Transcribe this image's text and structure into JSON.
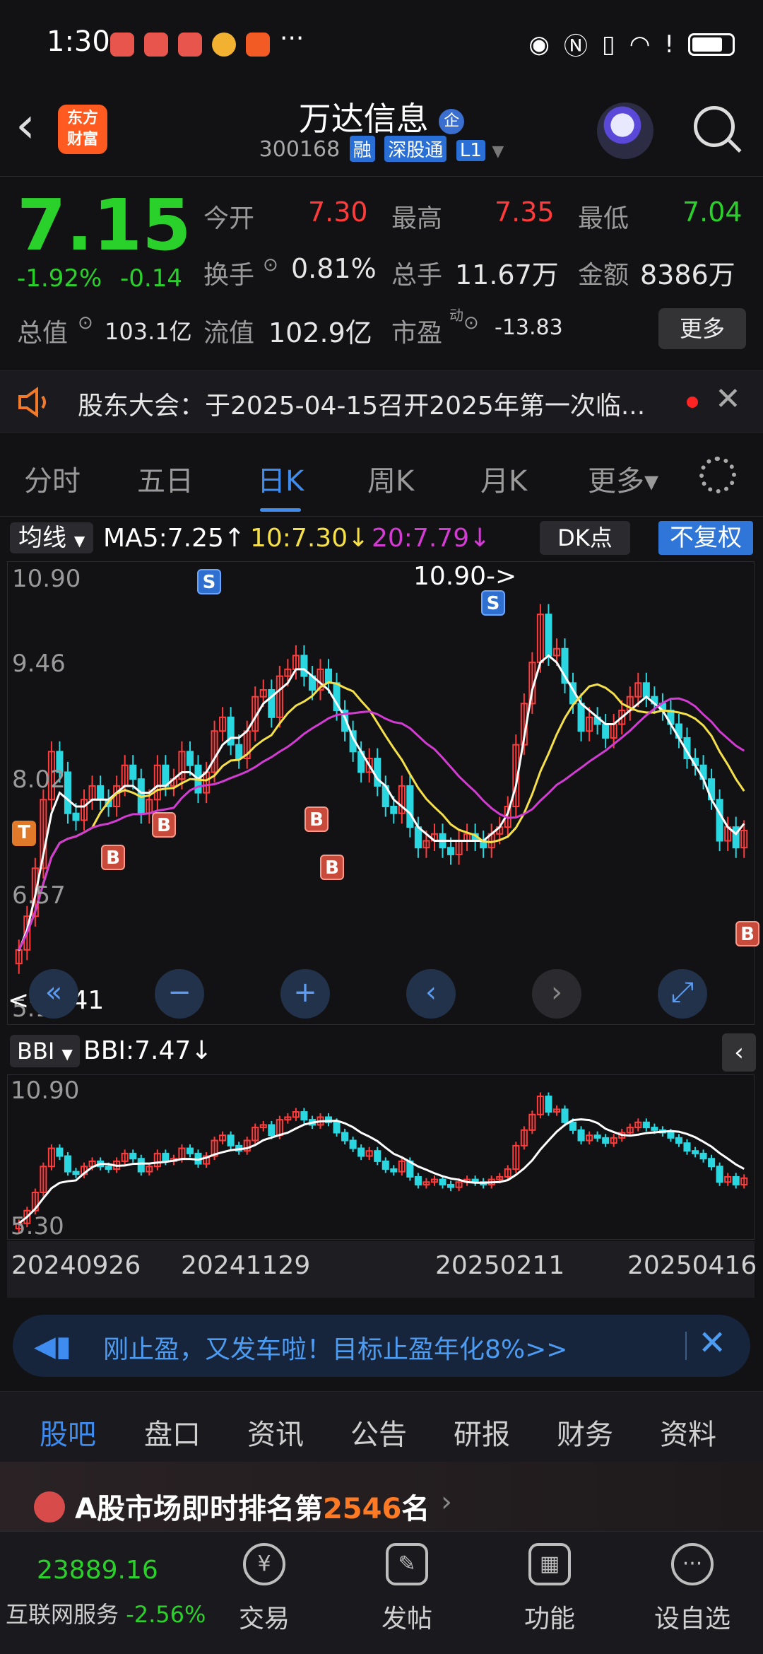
{
  "status_bar": {
    "time": "1:30",
    "more": "···"
  },
  "header": {
    "back_icon": "chevron-left-icon",
    "logo_line1": "东方",
    "logo_line2": "财富",
    "stock_name": "万达信息",
    "badge": "企",
    "code": "300168",
    "tags": [
      "融",
      "深股通",
      "L1"
    ]
  },
  "quote": {
    "price": "7.15",
    "change_pct": "-1.92%",
    "change_amt": "-0.14",
    "open_label": "今开",
    "open": "7.30",
    "high_label": "最高",
    "high": "7.35",
    "low_label": "最低",
    "low": "7.04",
    "turnover_label": "换手",
    "turnover": "0.81%",
    "volume_label": "总手",
    "volume": "11.67万",
    "amount_label": "金额",
    "amount": "8386万",
    "mktcap_label": "总值",
    "mktcap": "103.1亿",
    "float_label": "流值",
    "float": "102.9亿",
    "pe_label": "市盈",
    "pe_sup": "动",
    "pe": "-13.83",
    "more_button": "更多"
  },
  "notice": {
    "text": "股东大会：于2025-04-15召开2025年第一次临..."
  },
  "period_tabs": [
    "分时",
    "五日",
    "日K",
    "周K",
    "月K",
    "更多▾"
  ],
  "active_period": "日K",
  "ma_row": {
    "selector": "均线",
    "ma5": "MA5:7.25↑",
    "ma10": "10:7.30↓",
    "ma20": "20:7.79↓",
    "dk_button": "DK点",
    "adjust_button": "不复权",
    "colors": {
      "ma5": "#ffffff",
      "ma10": "#f5e04a",
      "ma20": "#d23cd2"
    }
  },
  "main_chart": {
    "y_ticks": [
      "10.90",
      "9.46",
      "8.02",
      "6.57",
      "5.13"
    ],
    "high_annotation": "10.90->",
    "low_annotation": "<--5.41",
    "markers": [
      "S",
      "S",
      "B",
      "B",
      "B",
      "B",
      "B",
      "T"
    ],
    "controls": [
      "«",
      "−",
      "+",
      "‹",
      "›",
      "⤢"
    ]
  },
  "bbi_row": {
    "selector": "BBI",
    "value": "BBI:7.47↓",
    "collapse": "‹"
  },
  "bbi_chart": {
    "y_ticks": [
      "10.90",
      "5.30"
    ]
  },
  "dates": [
    "20240926",
    "20241129",
    "20250211",
    "20250416"
  ],
  "promo": {
    "text": "刚止盈，又发车啦！目标止盈年化8%>>"
  },
  "bottom_tabs": [
    "股吧",
    "盘口",
    "资讯",
    "公告",
    "研报",
    "财务",
    "资料"
  ],
  "rank": {
    "prefix": "A股市场即时排名第",
    "number": "2546",
    "suffix": "名"
  },
  "bottom_nav": {
    "index_value": "23889.16",
    "index_name": "互联网服务",
    "index_change": "-2.56%",
    "items": [
      "交易",
      "发帖",
      "功能",
      "设自选"
    ]
  },
  "chart_data": {
    "type": "candlestick",
    "title": "",
    "x_range": [
      "20240926",
      "20250416"
    ],
    "ylim": [
      5.13,
      10.9
    ],
    "close": [
      5.41,
      5.9,
      6.6,
      7.6,
      8.3,
      8.0,
      7.4,
      7.3,
      7.6,
      7.8,
      7.6,
      7.5,
      7.8,
      8.1,
      7.9,
      7.4,
      7.6,
      8.1,
      7.8,
      7.9,
      8.3,
      8.1,
      7.7,
      8.0,
      8.6,
      8.8,
      8.4,
      8.2,
      8.6,
      9.1,
      9.2,
      8.8,
      9.4,
      9.5,
      9.7,
      9.4,
      9.2,
      9.5,
      9.3,
      8.9,
      8.6,
      8.3,
      8.0,
      8.2,
      7.8,
      7.5,
      7.4,
      7.8,
      7.2,
      6.9,
      7.0,
      7.1,
      6.9,
      6.8,
      7.0,
      7.1,
      7.0,
      6.9,
      7.1,
      7.2,
      7.5,
      8.4,
      9.0,
      9.6,
      10.3,
      9.7,
      9.8,
      9.3,
      9.0,
      8.6,
      8.8,
      8.7,
      8.5,
      8.7,
      8.9,
      9.1,
      9.3,
      9.1,
      9.0,
      8.9,
      8.7,
      8.5,
      8.2,
      8.1,
      7.9,
      7.6,
      7.0,
      7.2,
      6.9,
      7.15
    ],
    "ma5": [
      5.4,
      5.7,
      6.2,
      6.8,
      7.4,
      7.7,
      7.6,
      7.5,
      7.5,
      7.6,
      7.6,
      7.6,
      7.7,
      7.8,
      7.8,
      7.7,
      7.7,
      7.8,
      7.8,
      7.9,
      8.0,
      8.0,
      7.9,
      8.0,
      8.2,
      8.4,
      8.5,
      8.5,
      8.6,
      8.8,
      9.0,
      9.1,
      9.2,
      9.3,
      9.5,
      9.5,
      9.4,
      9.3,
      9.2,
      9.0,
      8.8,
      8.5,
      8.3,
      8.1,
      7.9,
      7.8,
      7.6,
      7.5,
      7.4,
      7.2,
      7.1,
      7.0,
      7.0,
      7.0,
      7.0,
      7.0,
      7.0,
      7.0,
      7.1,
      7.2,
      7.4,
      7.8,
      8.5,
      9.2,
      9.6,
      9.7,
      9.6,
      9.4,
      9.2,
      9.0,
      8.9,
      8.8,
      8.7,
      8.7,
      8.8,
      8.9,
      9.0,
      9.1,
      9.0,
      8.9,
      8.7,
      8.5,
      8.3,
      8.1,
      7.9,
      7.6,
      7.4,
      7.2,
      7.1,
      7.25
    ]
  }
}
